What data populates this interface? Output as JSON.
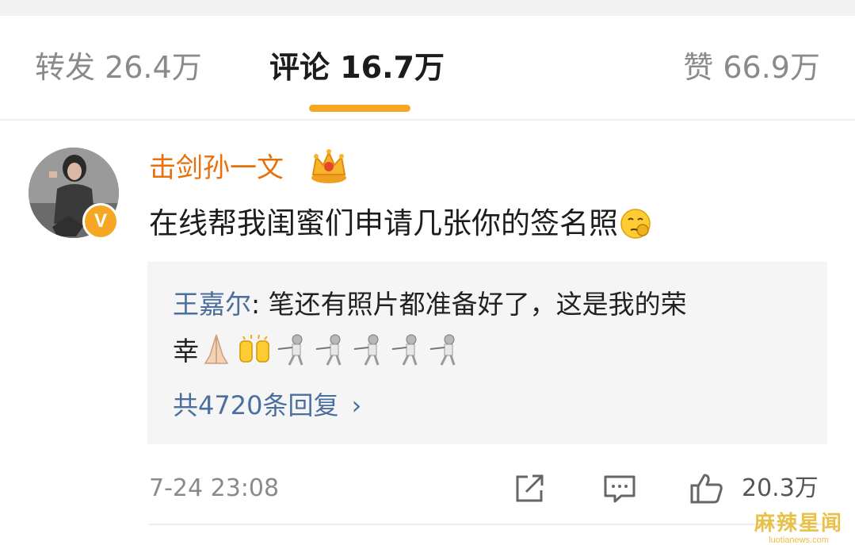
{
  "tabs": {
    "repost": "转发 26.4万",
    "comments": "评论 16.7万",
    "likes": "赞 66.9万"
  },
  "comment": {
    "username": "击剑孙一文",
    "text": "在线帮我闺蜜们申请几张你的签名照",
    "timestamp": "7-24 23:08",
    "like_count": "20.3万",
    "reply": {
      "author": "王嘉尔",
      "separator": ": ",
      "line1": "笔还有照片都准备好了，这是我的荣",
      "line2": "幸",
      "more_label": "共4720条回复",
      "more_chevron": "›"
    }
  },
  "icons": {
    "badge": "verified-badge-icon",
    "crown": "crown-icon",
    "inline_emoji": "pensive-face-icon",
    "reply_emojis": [
      "pray-icon",
      "raised-hands-icon",
      "fencer-icon",
      "fencer-icon",
      "fencer-icon",
      "fencer-icon",
      "fencer-icon"
    ],
    "actions": [
      "share-icon",
      "comment-icon",
      "like-icon"
    ]
  },
  "badge_letter": "V",
  "watermark": {
    "main": "麻辣星闻",
    "sub": "luotianews.com"
  },
  "colors": {
    "accent": "#f5a623",
    "username": "#e8700a",
    "link": "#4a6f9e"
  }
}
